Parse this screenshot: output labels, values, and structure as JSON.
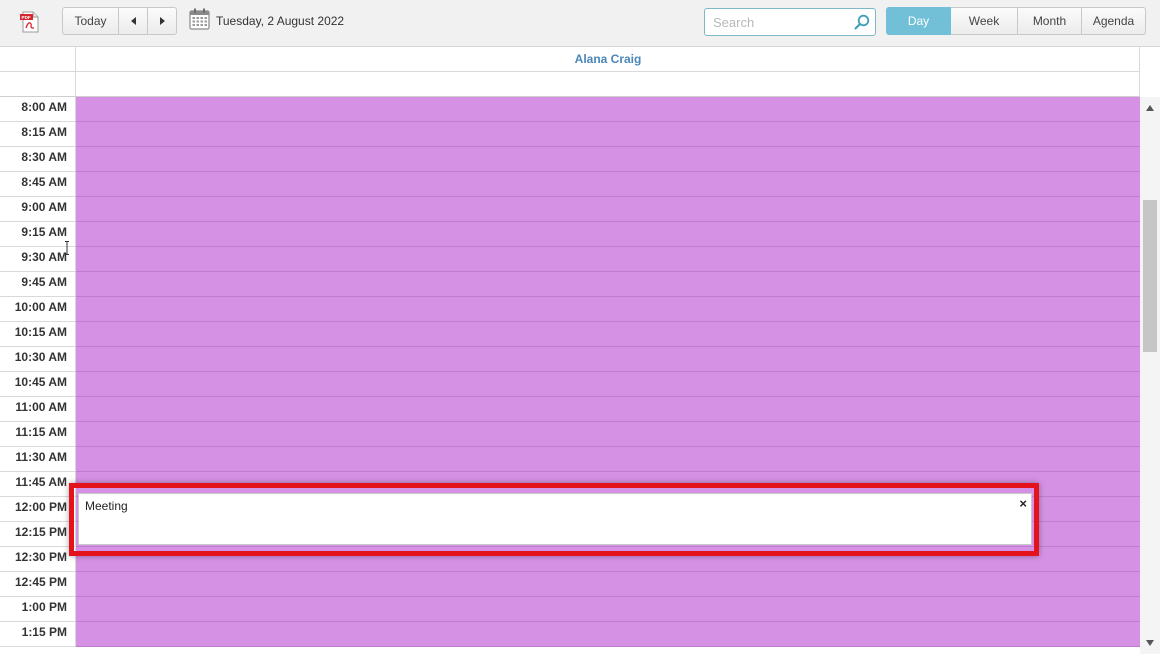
{
  "toolbar": {
    "pdf_icon": "pdf-export-icon",
    "pdf_badge": "PDF",
    "today_label": "Today",
    "prev_icon": "triangle-left-icon",
    "next_icon": "triangle-right-icon",
    "calendar_icon": "calendar-icon",
    "date_label": "Tuesday, 2 August 2022",
    "search_placeholder": "Search",
    "search_value": "",
    "search_icon": "magnifier-icon",
    "views": [
      {
        "label": "Day",
        "active": true
      },
      {
        "label": "Week",
        "active": false
      },
      {
        "label": "Month",
        "active": false
      },
      {
        "label": "Agenda",
        "active": false
      }
    ]
  },
  "header": {
    "resource_name": "Alana Craig"
  },
  "colors": {
    "slot_background": "#d592e4",
    "active_view": "#72c0d8",
    "resource_text": "#4a86b8",
    "highlight_border": "#e3121b"
  },
  "time_slots": [
    "8:00 AM",
    "8:15 AM",
    "8:30 AM",
    "8:45 AM",
    "9:00 AM",
    "9:15 AM",
    "9:30 AM",
    "9:45 AM",
    "10:00 AM",
    "10:15 AM",
    "10:30 AM",
    "10:45 AM",
    "11:00 AM",
    "11:15 AM",
    "11:30 AM",
    "11:45 AM",
    "12:00 PM",
    "12:15 PM",
    "12:30 PM",
    "12:45 PM",
    "1:00 PM",
    "1:15 PM"
  ],
  "event": {
    "title": "Meeting",
    "close_symbol": "×"
  }
}
